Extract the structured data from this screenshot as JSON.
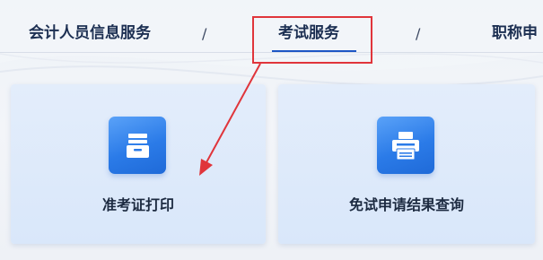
{
  "nav": {
    "items": [
      {
        "label": "会计人员信息服务"
      },
      {
        "label": "考试服务"
      },
      {
        "label": "职称申"
      }
    ],
    "separator": "/",
    "active_index": 1
  },
  "cards": [
    {
      "label": "准考证打印",
      "icon": "file-cabinet-icon"
    },
    {
      "label": "免试申请结果查询",
      "icon": "printer-icon"
    }
  ],
  "colors": {
    "accent": "#1d56c5",
    "annotation_red": "#e0353b",
    "card_bg": "#dde9fa",
    "icon_blue": "#2b7be8",
    "text_dark": "#1c2f52"
  }
}
